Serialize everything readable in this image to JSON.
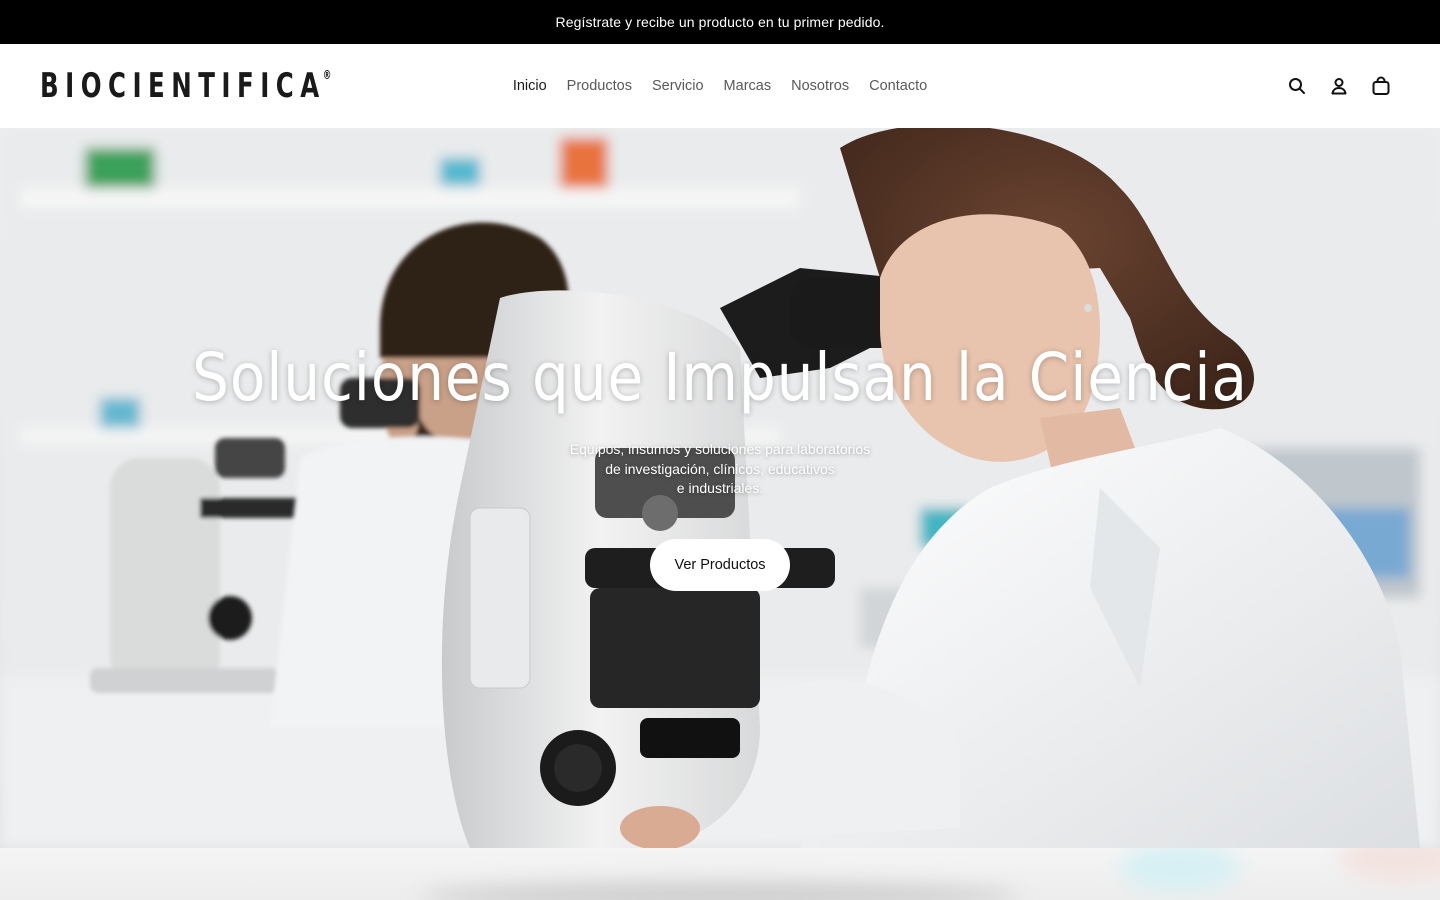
{
  "announcement": {
    "text": "Regístrate y recibe un producto en tu primer pedido."
  },
  "brand": {
    "name": "BIOCIENTIFICA",
    "registered_mark": "®"
  },
  "nav": {
    "items": [
      {
        "label": "Inicio",
        "active": true
      },
      {
        "label": "Productos",
        "active": false
      },
      {
        "label": "Servicio",
        "active": false
      },
      {
        "label": "Marcas",
        "active": false
      },
      {
        "label": "Nosotros",
        "active": false
      },
      {
        "label": "Contacto",
        "active": false
      }
    ]
  },
  "header_icons": [
    "search-icon",
    "account-icon",
    "cart-icon"
  ],
  "hero": {
    "title": "Soluciones que Impulsan la Ciencia",
    "subtitle_lines": [
      "Equipos, insumos y soluciones para laboratorios",
      "de investigación, clínicos, educativos",
      "e industriales."
    ],
    "cta_label": "Ver Productos",
    "image_description": "lab-scientists-with-microscopes"
  },
  "colors": {
    "announcement_bg": "#000000",
    "announcement_text": "#ffffff",
    "nav_active": "#1a1a1a",
    "nav_inactive": "#5a5a5a",
    "button_bg": "#ffffff"
  }
}
